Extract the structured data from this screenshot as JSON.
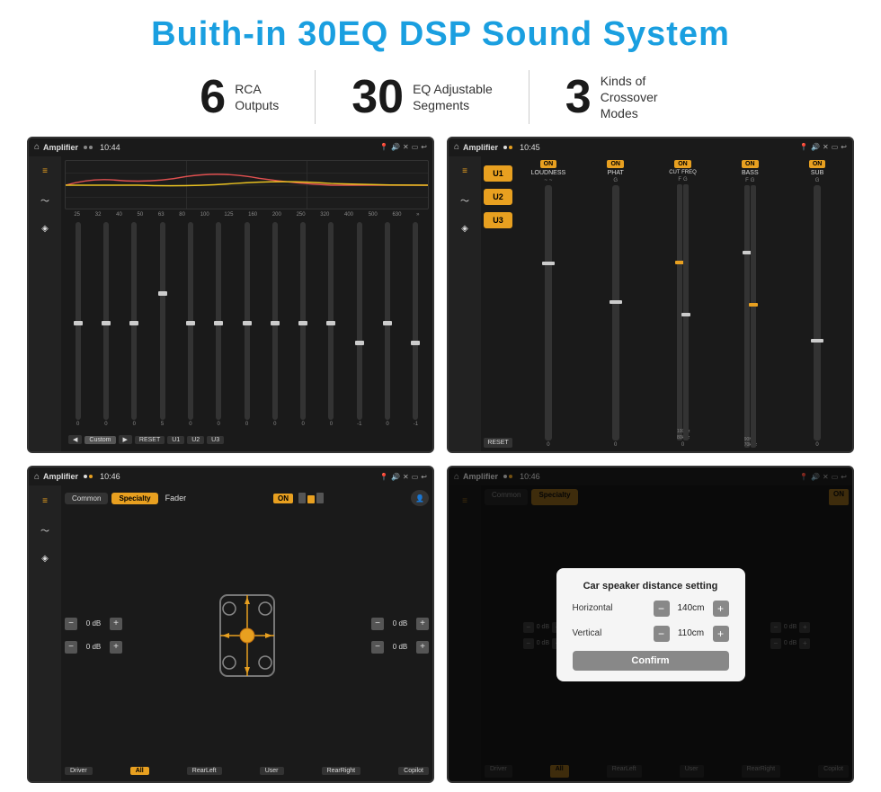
{
  "header": {
    "title": "Buith-in 30EQ DSP Sound System"
  },
  "stats": [
    {
      "number": "6",
      "label": "RCA\nOutputs"
    },
    {
      "number": "30",
      "label": "EQ Adjustable\nSegments"
    },
    {
      "number": "3",
      "label": "Kinds of\nCrossover Modes"
    }
  ],
  "screens": [
    {
      "id": "eq-screen",
      "status_bar": {
        "app_name": "Amplifier",
        "time": "10:44"
      }
    },
    {
      "id": "crossover-screen",
      "status_bar": {
        "app_name": "Amplifier",
        "time": "10:45"
      }
    },
    {
      "id": "fader-screen",
      "status_bar": {
        "app_name": "Amplifier",
        "time": "10:46"
      }
    },
    {
      "id": "dialog-screen",
      "status_bar": {
        "app_name": "Amplifier",
        "time": "10:46"
      },
      "dialog": {
        "title": "Car speaker distance setting",
        "horizontal_label": "Horizontal",
        "horizontal_value": "140cm",
        "vertical_label": "Vertical",
        "vertical_value": "110cm",
        "confirm_label": "Confirm"
      }
    }
  ],
  "eq": {
    "freq_labels": [
      "25",
      "32",
      "40",
      "50",
      "63",
      "80",
      "100",
      "125",
      "160",
      "200",
      "250",
      "320",
      "400",
      "500",
      "630"
    ],
    "values": [
      "0",
      "0",
      "0",
      "5",
      "0",
      "0",
      "0",
      "0",
      "0",
      "0",
      "-1",
      "0",
      "-1"
    ],
    "presets": [
      "Custom",
      "RESET",
      "U1",
      "U2",
      "U3"
    ]
  },
  "crossover": {
    "u_buttons": [
      "U1",
      "U2",
      "U3"
    ],
    "channels": [
      {
        "name": "LOUDNESS",
        "on": true
      },
      {
        "name": "PHAT",
        "on": true
      },
      {
        "name": "CUT FREQ",
        "on": true
      },
      {
        "name": "BASS",
        "on": true
      },
      {
        "name": "SUB",
        "on": true
      }
    ],
    "reset_label": "RESET"
  },
  "fader": {
    "tabs": [
      "Common",
      "Specialty"
    ],
    "active_tab": "Specialty",
    "fader_label": "Fader",
    "on_label": "ON",
    "db_controls": [
      {
        "value": "0 dB"
      },
      {
        "value": "0 dB"
      },
      {
        "value": "0 dB"
      },
      {
        "value": "0 dB"
      }
    ],
    "bottom_buttons": [
      "Driver",
      "All",
      "RearLeft",
      "User",
      "RearRight",
      "Copilot"
    ]
  },
  "colors": {
    "accent_blue": "#1a9fe0",
    "accent_orange": "#e8a020",
    "dark_bg": "#1a1a1a",
    "darker_bg": "#111"
  }
}
